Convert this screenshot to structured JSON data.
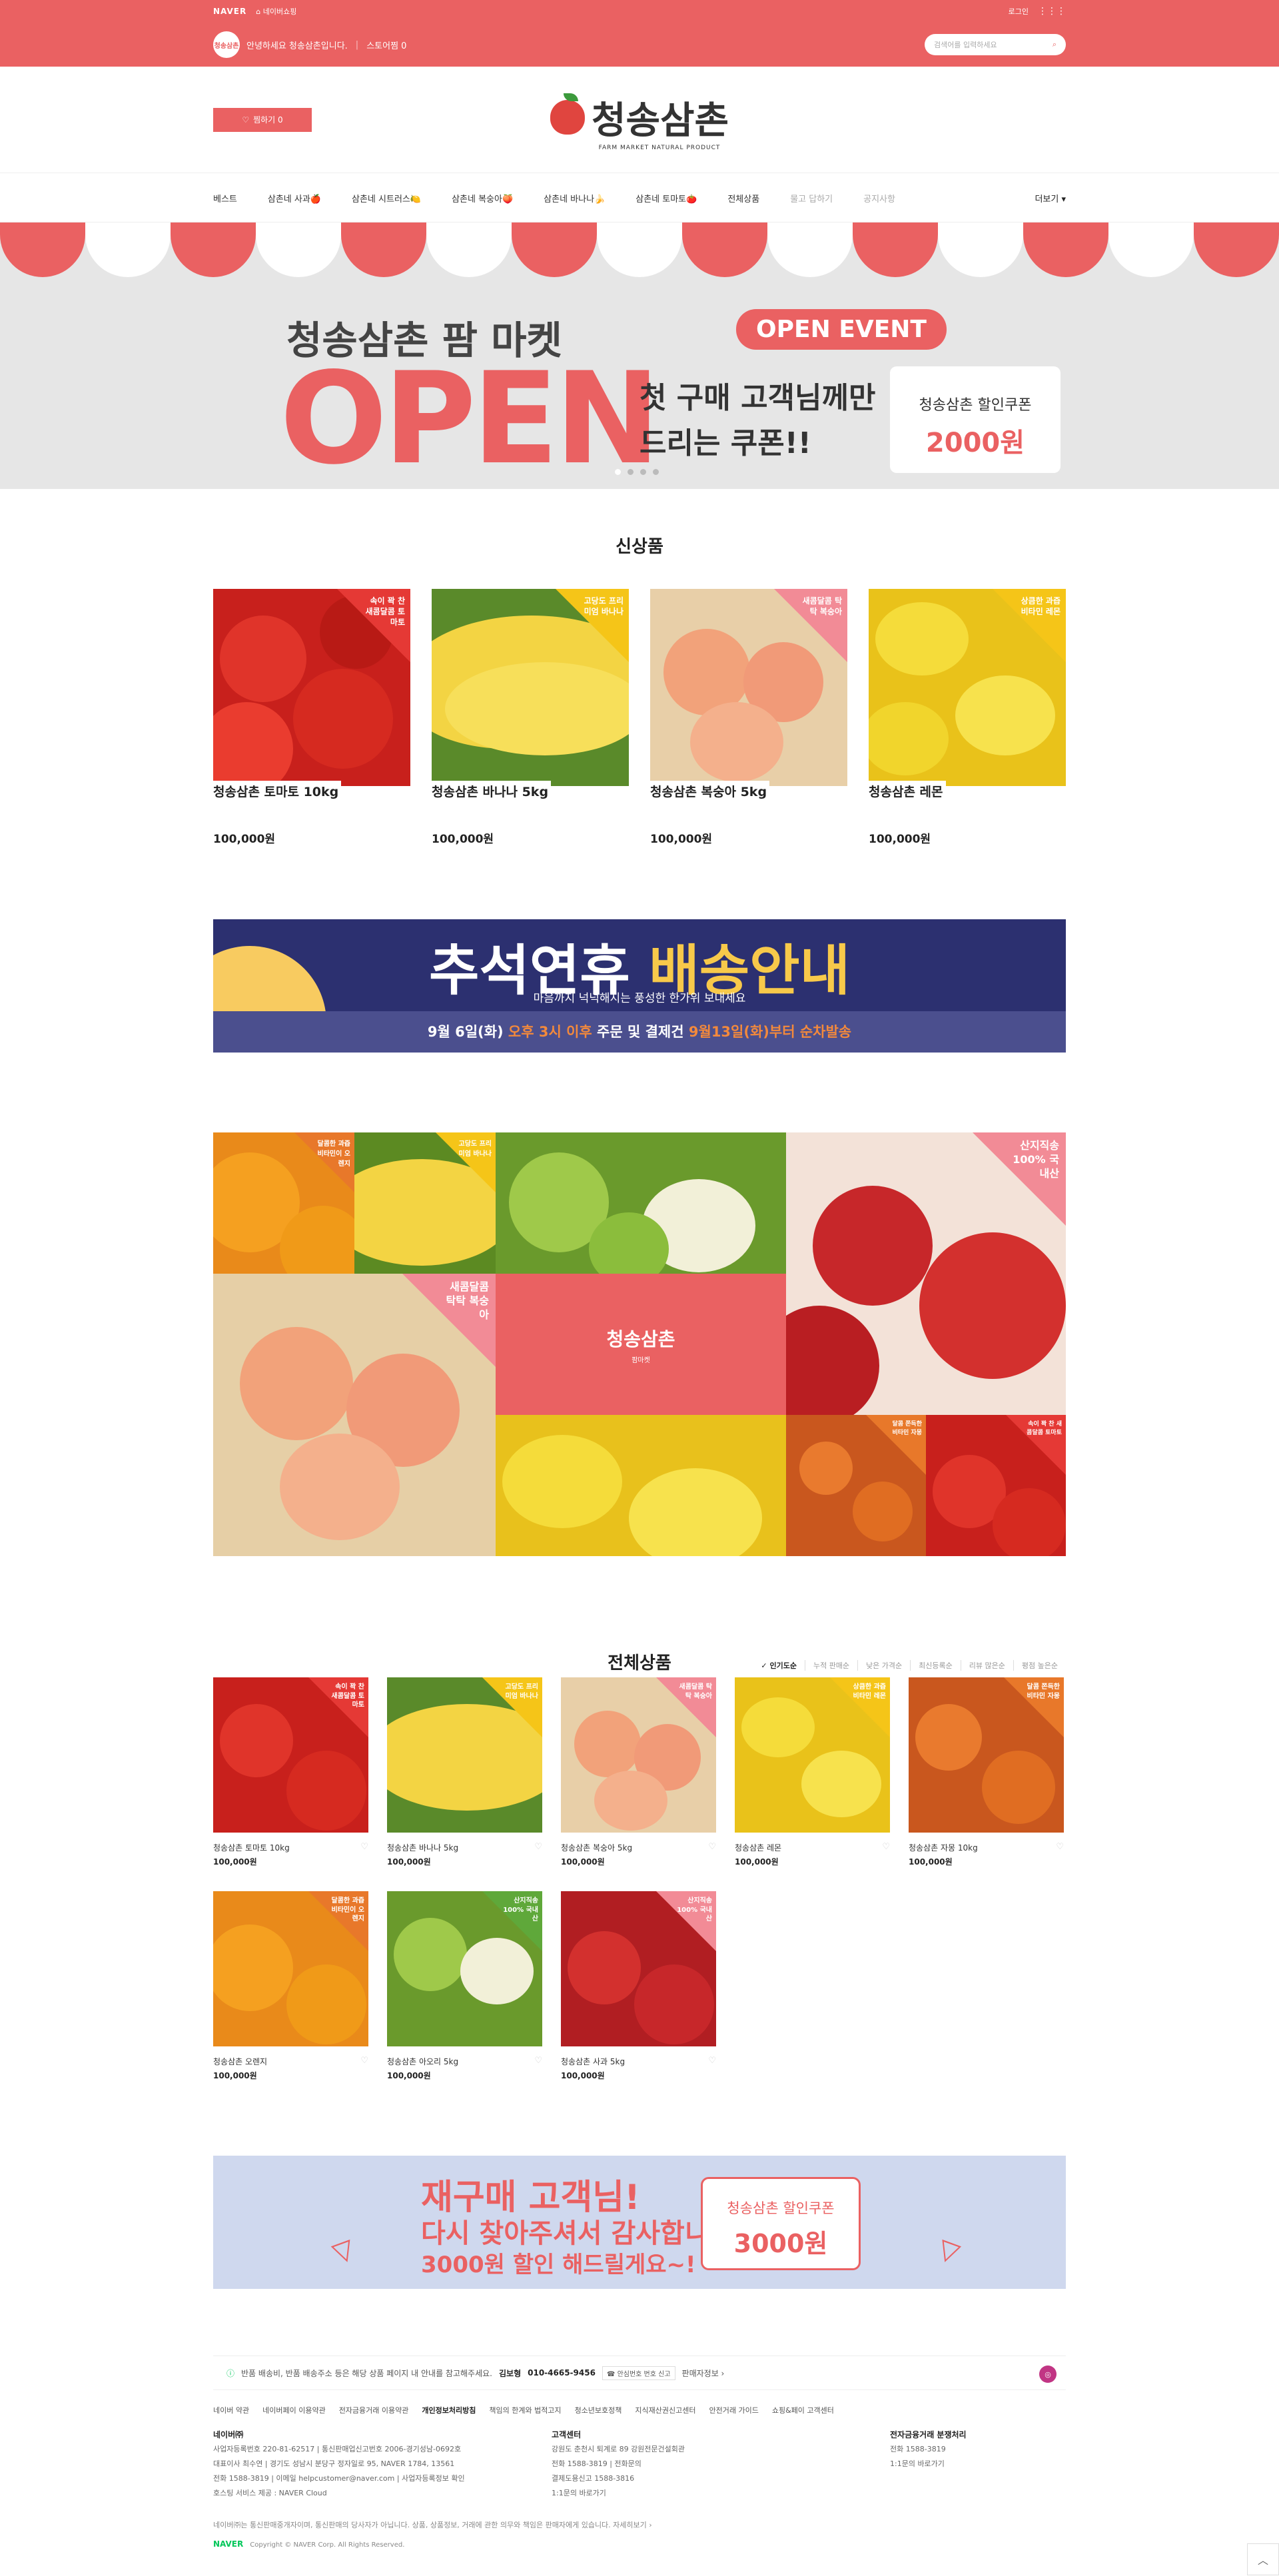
{
  "topbar": {
    "naver": "NAVER",
    "store_link": "네이버쇼핑",
    "login": "로그인",
    "greeting": "안녕하세요 청송삼촌입니다.",
    "store_like": "스토어찜 0",
    "avatar_text": "청송삼촌",
    "search_placeholder": "검색어를 입력하세요"
  },
  "header": {
    "like_label": "찜하기 0",
    "brand_name": "청송삼촌",
    "brand_sub": "FARM MARKET NATURAL PRODUCT"
  },
  "nav": {
    "items": [
      "베스트",
      "삼촌네 사과🍎",
      "삼촌네 시트러스🍋",
      "삼촌네 복숭아🍑",
      "삼촌네 바나나🍌",
      "삼촌네 토마토🍅",
      "전체상품",
      "물고 답하기",
      "공지사항"
    ],
    "more": "더보기 ▾"
  },
  "hero": {
    "title": "청송삼촌 팜 마켓",
    "open": "OPEN",
    "event": "OPEN EVENT",
    "sub1": "첫 구매 고객님께만",
    "sub2": "드리는 쿠폰!!",
    "coupon_label": "청송삼촌 할인쿠폰",
    "coupon_value": "2000원",
    "colors": {
      "red": "#ea6162",
      "white": "#ffffff"
    }
  },
  "new_products": {
    "title": "신상품",
    "items": [
      {
        "name": "청송삼촌 토마토 10kg",
        "price": "100,000원",
        "tag": "속이 꽉 찬 새콤달콤 토마토"
      },
      {
        "name": "청송삼촌 바나나 5kg",
        "price": "100,000원",
        "tag": "고당도 프리미엄 바나나"
      },
      {
        "name": "청송삼촌 복숭아 5kg",
        "price": "100,000원",
        "tag": "새콤달콤 탁탁 복숭아"
      },
      {
        "name": "청송삼촌 레몬",
        "price": "100,000원",
        "tag": "상큼한 과즙 비타민 레몬"
      }
    ]
  },
  "banner_chuseok": {
    "title_a": "추석연휴",
    "title_b": "배송안내",
    "sub": "마음까지 넉넉해지는 풍성한 한가위 보내세요",
    "bottom_a": "9월 6일(화)",
    "bottom_b": "오후 3시 이후",
    "bottom_c": "주문 및 결제건",
    "bottom_d": "9월13일(화)부터 순차발송"
  },
  "collage": {
    "brand": "청송삼촌",
    "brand_sub": "팜마켓",
    "tags": {
      "orange": "달콤한 과즙 비타민이 오렌지",
      "banana": "고당도 프리미엄 바나나",
      "apple_big": "산지직송 100% 국내산",
      "peach": "새콤달콤 탁탁 복숭아",
      "persimmon": "달콤 쫀득한 비타민 자몽",
      "tomato": "속이 꽉 찬 새콤달콤 토마토"
    }
  },
  "all_products": {
    "title": "전체상품",
    "sort": [
      "✓ 인기도순",
      "누적 판매순",
      "낮은 가격순",
      "최신등록순",
      "리뷰 많은순",
      "평점 높은순"
    ],
    "items": [
      {
        "name": "청송삼촌 토마토 10kg",
        "price": "100,000원",
        "tag": "속이 꽉 찬 새콤달콤 토마토"
      },
      {
        "name": "청송삼촌 바나나 5kg",
        "price": "100,000원",
        "tag": "고당도 프리미엄 바나나"
      },
      {
        "name": "청송삼촌 복숭아 5kg",
        "price": "100,000원",
        "tag": "새콤달콤 탁탁 복숭아"
      },
      {
        "name": "청송삼촌 레몬",
        "price": "100,000원",
        "tag": "상큼한 과즙 비타민 레몬"
      },
      {
        "name": "청송삼촌 자몽 10kg",
        "price": "100,000원",
        "tag": "달콤 쫀득한 비타민 자몽"
      },
      {
        "name": "청송삼촌 오렌지",
        "price": "100,000원",
        "tag": "달콤한 과즙 비타민이 오렌지"
      },
      {
        "name": "청송삼촌 아오리 5kg",
        "price": "100,000원",
        "tag": "산지직송 100% 국내산"
      },
      {
        "name": "청송삼촌 사과 5kg",
        "price": "100,000원",
        "tag": "산지직송 100% 국내산"
      }
    ]
  },
  "banner_repurchase": {
    "line1": "재구매 고객님!",
    "line2": "다시 찾아주셔서 감사합니다!",
    "line3": "3000원 할인 해드릴게요~!",
    "coupon_label": "청송삼촌 할인쿠폰",
    "coupon_value": "3000원"
  },
  "footer": {
    "info": "반품 배송비, 반품 배송주소 등은 해당 상품 페이지 내 안내를 참고해주세요.",
    "talk_label": "김보형",
    "talk_phone": "010-4665-9456",
    "safe_number": "☎ 안심번호 번호 신고",
    "seller_info": "판매자정보 ›",
    "links": [
      "네이버 약관",
      "네이버페이 이용약관",
      "전자금융거래 이용약관",
      "개인정보처리방침",
      "책임의 한계와 법적고지",
      "청소년보호정책",
      "지식재산권신고센터",
      "안전거래 가이드",
      "쇼핑&페이 고객센터"
    ],
    "col1_title": "네이버㈜",
    "col1_lines": [
      "사업자등록번호 220-81-62517 | 통신판매업신고번호 2006-경기성남-0692호",
      "대표이사 최수연 | 경기도 성남시 분당구 정자일로 95, NAVER 1784, 13561",
      "전화 1588-3819 | 이메일 helpcustomer@naver.com | 사업자등록정보 확인",
      "호스팅 서비스 제공 : NAVER Cloud"
    ],
    "col2_title": "고객센터",
    "col2_lines": [
      "강원도 춘천시 퇴계로 89 강원전문건설회관",
      "전화 1588-3819 | 전화문의",
      "결제도용신고 1588-3816",
      "1:1문의 바로가기"
    ],
    "col3_title": "전자금융거래 분쟁처리",
    "col3_lines": [
      "전화 1588-3819",
      "1:1문의 바로가기"
    ],
    "note": "네이버㈜는 통신판매중개자이며, 통신판매의 당사자가 아닙니다. 상품, 상품정보, 거래에 관한 의무와 책임은 판매자에게 있습니다. 자세히보기 ›",
    "copyright": "Copyright © NAVER Corp. All Rights Reserved."
  }
}
